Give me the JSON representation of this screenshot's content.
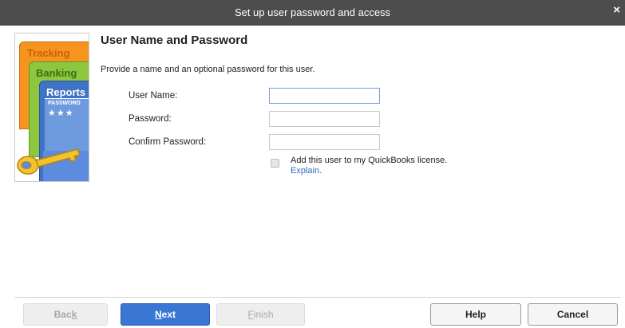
{
  "window": {
    "title": "Set up user password and access",
    "close_glyph": "×"
  },
  "illustration": {
    "tab_tracking": "Tracking",
    "tab_banking": "Banking",
    "tab_reports": "Reports",
    "password_label": "PASSWORD",
    "password_stars": "★★★",
    "colors": {
      "tracking": "#f7941d",
      "banking": "#8dc63f",
      "reports": "#3f73c6",
      "key": "#f2c230"
    }
  },
  "content": {
    "heading": "User Name and Password",
    "description": "Provide a name and an optional password for this user.",
    "user_name_label": "User Name:",
    "user_name_value": "",
    "password_label": "Password:",
    "password_value": "",
    "confirm_password_label": "Confirm Password:",
    "confirm_password_value": "",
    "add_license_label": "Add this user to my QuickBooks license.",
    "add_license_checked": false,
    "explain_link": "Explain."
  },
  "footer": {
    "back_pre": "Bac",
    "back_key": "k",
    "next_key": "N",
    "next_post": "ext",
    "finish_key": "F",
    "finish_post": "inish",
    "help": "Help",
    "cancel": "Cancel",
    "accent_color": "#3a77d4"
  }
}
